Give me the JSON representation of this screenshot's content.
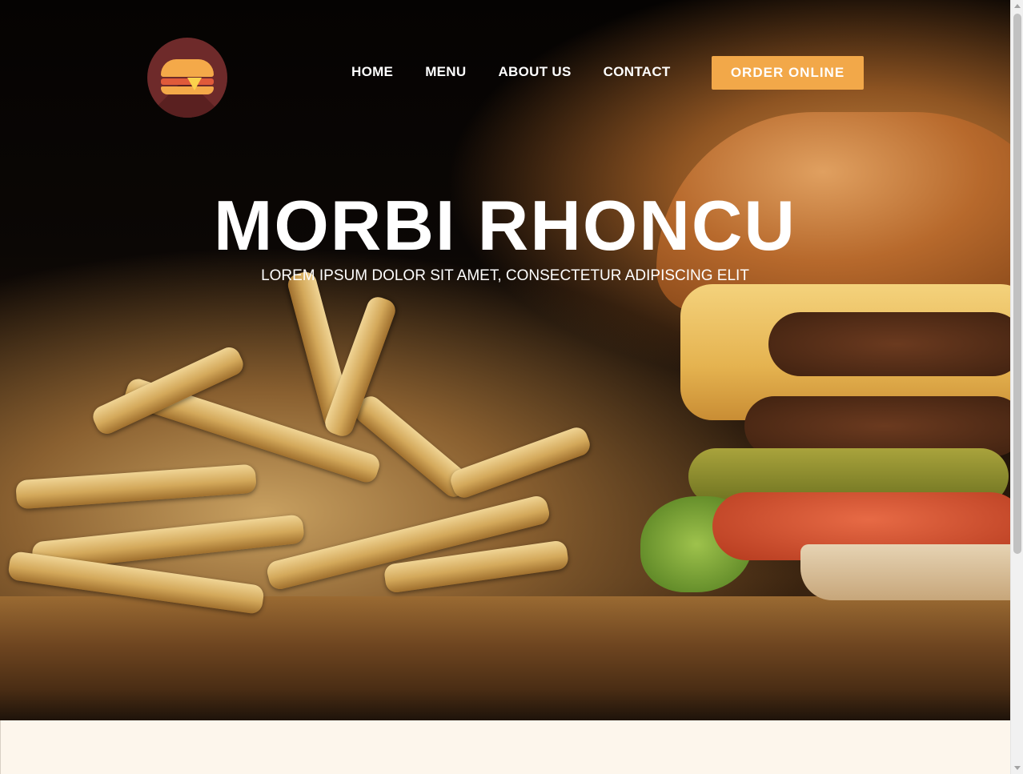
{
  "header": {
    "logo_name": "burger-logo-icon",
    "nav": [
      {
        "label": "HOME"
      },
      {
        "label": "MENU"
      },
      {
        "label": "ABOUT US"
      },
      {
        "label": "CONTACT"
      }
    ],
    "cta_label": "ORDER ONLINE"
  },
  "hero": {
    "title": "MORBI RHONCU",
    "subtitle": "LOREM IPSUM DOLOR SIT AMET, CONSECTETUR ADIPISCING ELIT"
  },
  "colors": {
    "accent": "#f2a849",
    "logo_bg": "#6e2a2a",
    "page_bg": "#fdf6ec"
  }
}
